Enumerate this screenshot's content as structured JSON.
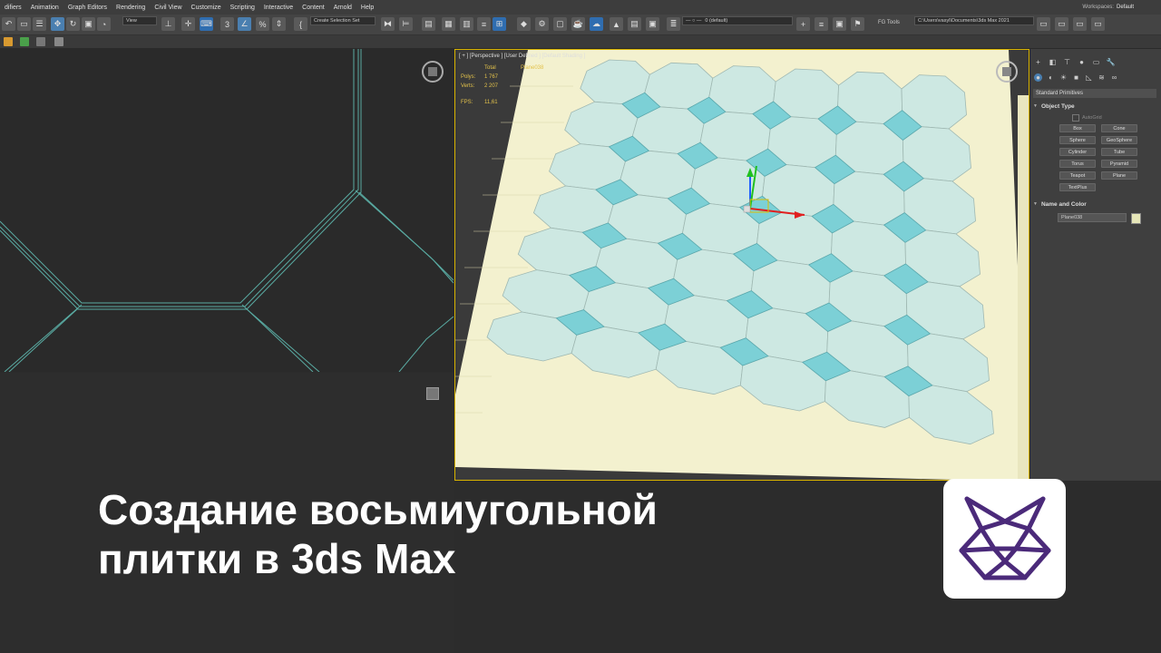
{
  "menubar": {
    "items": [
      "difiers",
      "Animation",
      "Graph Editors",
      "Rendering",
      "Civil View",
      "Customize",
      "Scripting",
      "Interactive",
      "Content",
      "Arnold",
      "Help"
    ],
    "workspaces_label": "Workspaces:",
    "workspaces_value": "Default"
  },
  "toolbar": {
    "view_dropdown": "View",
    "selection_set": "Create Selection Set",
    "layer_dropdown": "0 (default)",
    "fg_tools": "FG Tools",
    "project_path": "C:\\Users\\vasyl\\Documents\\3ds Max 2021"
  },
  "viewport": {
    "label": "[ + ] [Perspective ] [User Defined ] [Default Shading ]",
    "stats": {
      "header": "Total",
      "object": "Plane038",
      "polys_label": "Polys:",
      "polys_value": "1 767",
      "verts_label": "Verts:",
      "verts_value": "2 207",
      "fps_label": "FPS:",
      "fps_value": "11,61"
    }
  },
  "command_panel": {
    "dropdown": "Standard Primitives",
    "object_type_title": "Object Type",
    "autogrid": "AutoGrid",
    "buttons": [
      "Box",
      "Cone",
      "Sphere",
      "GeoSphere",
      "Cylinder",
      "Tube",
      "Torus",
      "Pyramid",
      "Teapot",
      "Plane",
      "TextPlus"
    ],
    "name_color_title": "Name and Color",
    "name_value": "Plane038",
    "color_swatch": "#e6e6b8"
  },
  "overlay": {
    "title_line1": "Создание восьмиугольной",
    "title_line2": "плитки в 3ds Max",
    "logo_color": "#4b2a7a"
  },
  "colors": {
    "tile": "#cde8e2",
    "insert": "#7cd0d6",
    "floor": "#f3f1cf",
    "wire": "#5fb9b0"
  }
}
